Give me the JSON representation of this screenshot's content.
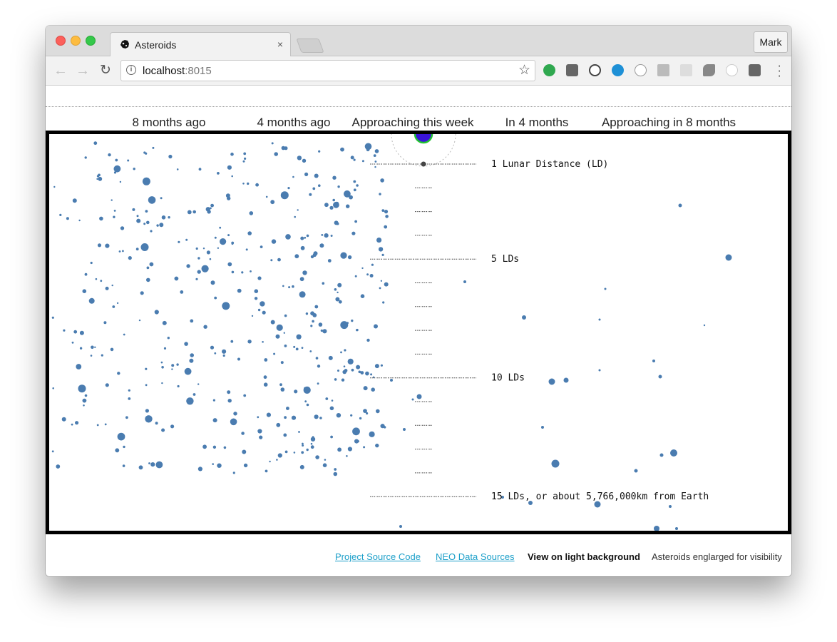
{
  "browser": {
    "tab_title": "Asteroids",
    "tab_close": "×",
    "profile_label": "Mark",
    "url_host": "localhost",
    "url_port": ":8015"
  },
  "timeline": {
    "columns": [
      {
        "label": "8 months ago"
      },
      {
        "label": "4 months ago"
      },
      {
        "label": "Approaching this week"
      },
      {
        "label": "In 4 months"
      },
      {
        "label": "Approaching in 8 months"
      }
    ]
  },
  "scale": {
    "labels": [
      "1 Lunar Distance (LD)",
      "5 LDs",
      "10 LDs",
      "15 LDs, or about 5,766,000km from Earth"
    ]
  },
  "footer": {
    "source_code": "Project Source Code",
    "neo_sources": "NEO Data Sources",
    "light_bg": "View on light background",
    "note": "Asteroids englarged for visibility"
  },
  "colors": {
    "asteroid": "#4a7cb0",
    "earth_fill": "#3a14d8",
    "earth_ring": "#22c232",
    "link": "#1b9fc9"
  }
}
